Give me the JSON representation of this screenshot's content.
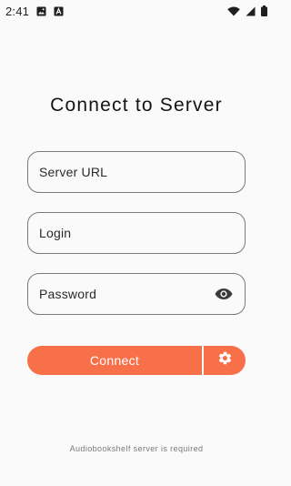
{
  "status_bar": {
    "time": "2:41",
    "icons": [
      "image-icon",
      "font-icon",
      "wifi-icon",
      "signal-icon",
      "battery-icon"
    ]
  },
  "title": "Connect to Server",
  "fields": {
    "server_url": {
      "placeholder": "Server URL",
      "value": ""
    },
    "login": {
      "placeholder": "Login",
      "value": ""
    },
    "password": {
      "placeholder": "Password",
      "value": "",
      "toggle_icon": "eye-icon"
    }
  },
  "actions": {
    "connect_label": "Connect",
    "settings_icon": "gear-icon"
  },
  "footer": {
    "note": "Audiobookshelf server is required"
  },
  "colors": {
    "accent": "#f8704a",
    "background": "#fafafa",
    "border": "#7a7a7a",
    "text": "#141414"
  }
}
